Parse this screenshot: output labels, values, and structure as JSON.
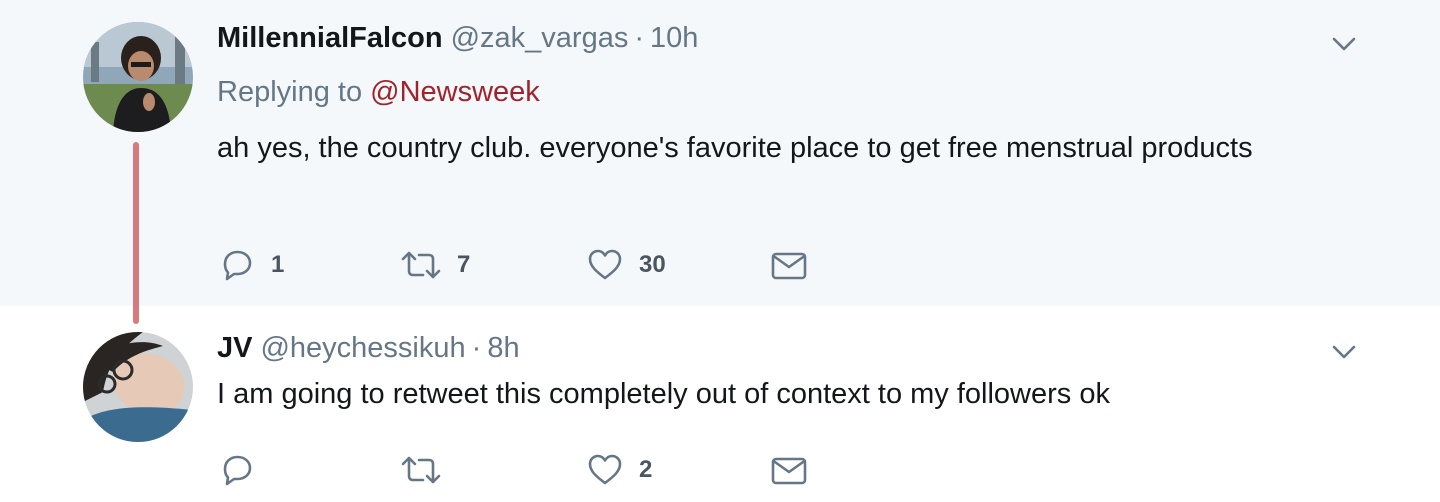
{
  "tweets": [
    {
      "display_name": "MillennialFalcon",
      "handle": "@zak_vargas",
      "separator": "·",
      "time": "10h",
      "replying_prefix": "Replying to",
      "replying_to": "@Newsweek",
      "text": "ah yes, the country club. everyone's favorite place to get free menstrual products",
      "reply_count": "1",
      "retweet_count": "7",
      "like_count": "30",
      "avatar_icon": "avatar-photo-icon"
    },
    {
      "display_name": "JV",
      "handle": "@heychessikuh",
      "separator": "·",
      "time": "8h",
      "text": "I am going to retweet this completely out of context to my followers ok",
      "reply_count": "",
      "retweet_count": "",
      "like_count": "2",
      "avatar_icon": "avatar-photo-icon"
    }
  ],
  "colors": {
    "thread_line": "#d7797f",
    "mention_link": "#a0232c",
    "muted_text": "#657786",
    "icon_gray": "#657786",
    "highlight_background": "#f5f8fa"
  },
  "icons": {
    "reply": "reply-icon",
    "retweet": "retweet-icon",
    "like": "heart-icon",
    "direct_message": "envelope-icon",
    "more": "chevron-down-icon"
  }
}
